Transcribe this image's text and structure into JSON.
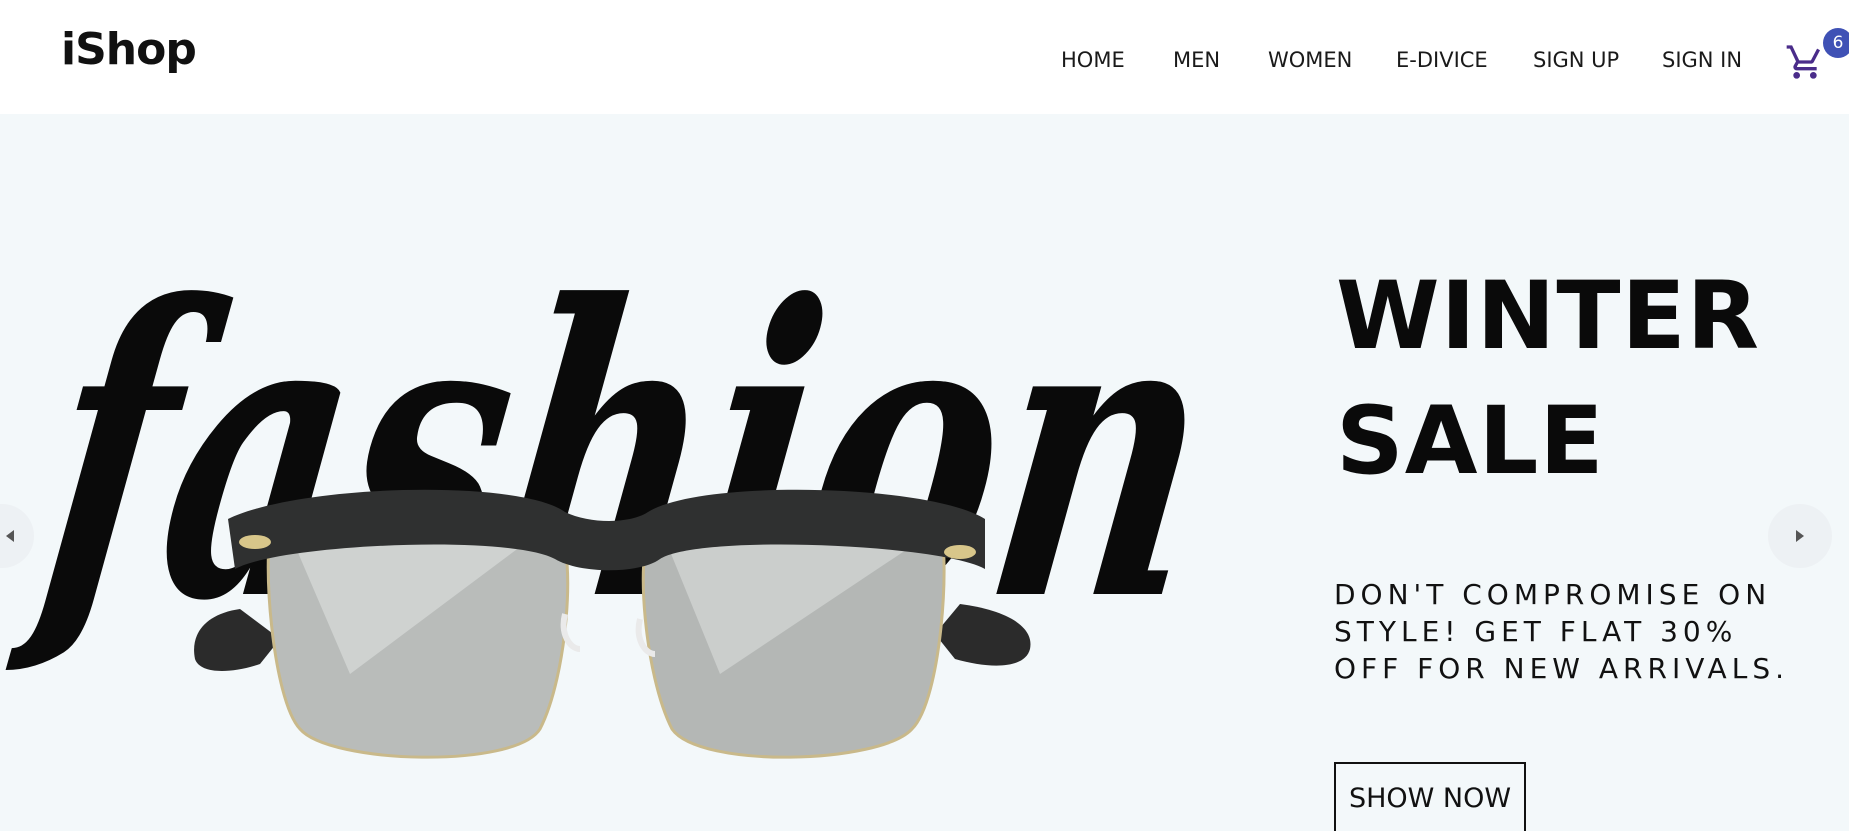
{
  "header": {
    "logo": "iShop",
    "nav": [
      {
        "label": "HOME",
        "name": "nav-home"
      },
      {
        "label": "MEN",
        "name": "nav-men"
      },
      {
        "label": "WOMEN",
        "name": "nav-women"
      },
      {
        "label": "E-DIVICE",
        "name": "nav-e-divice"
      },
      {
        "label": "SIGN UP",
        "name": "nav-sign-up"
      },
      {
        "label": "SIGN IN",
        "name": "nav-sign-in"
      }
    ],
    "cart": {
      "icon": "cart-icon",
      "count": "6"
    }
  },
  "hero": {
    "art_text": "fashion",
    "image": "sunglasses",
    "headline_line1": "WINTER",
    "headline_line2": "SALE",
    "subtext": "DON'T COMPROMISE ON STYLE! GET FLAT 30% OFF FOR NEW ARRIVALS.",
    "cta_label": "SHOW NOW",
    "prev_icon": "caret-left-icon",
    "next_icon": "caret-right-icon"
  },
  "colors": {
    "accent": "#3f51b5",
    "cart_icon": "#4a2c8a",
    "hero_background": "#f3f8fa",
    "text": "#111111"
  }
}
